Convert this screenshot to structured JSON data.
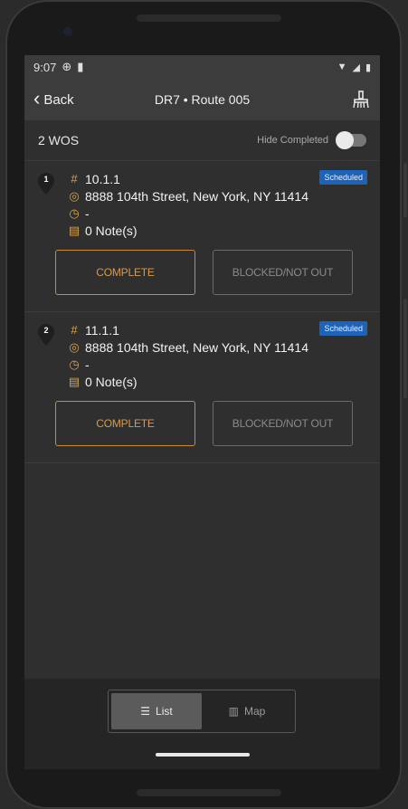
{
  "status": {
    "time": "9:07"
  },
  "topbar": {
    "back_label": "Back",
    "title": "DR7 • Route 005"
  },
  "subheader": {
    "count_label": "2 WOS",
    "hide_label": "Hide Completed"
  },
  "work_orders": [
    {
      "index": "1",
      "id": "10.1.1",
      "status": "Scheduled",
      "address": "8888 104th Street, New York, NY 11414",
      "time": "-",
      "notes": "0 Note(s)",
      "complete_label": "COMPLETE",
      "blocked_label": "BLOCKED/NOT OUT"
    },
    {
      "index": "2",
      "id": "11.1.1",
      "status": "Scheduled",
      "address": "8888 104th Street, New York, NY 11414",
      "time": "-",
      "notes": "0 Note(s)",
      "complete_label": "COMPLETE",
      "blocked_label": "BLOCKED/NOT OUT"
    }
  ],
  "bottom": {
    "list_label": "List",
    "map_label": "Map"
  },
  "colors": {
    "accent": "#d79a4d",
    "badge": "#1e63b8"
  }
}
